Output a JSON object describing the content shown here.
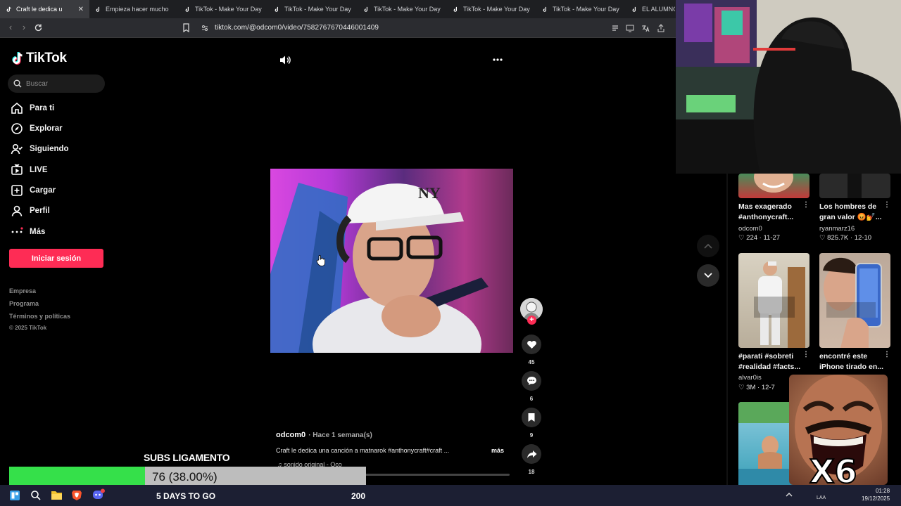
{
  "browser": {
    "tabs": [
      {
        "label": "Craft le dedica una canción",
        "active": true
      },
      {
        "label": "Empieza hacer mucho calor",
        "active": false
      },
      {
        "label": "TikTok - Make Your Day",
        "active": false
      },
      {
        "label": "TikTok - Make Your Day",
        "active": false
      },
      {
        "label": "TikTok - Make Your Day",
        "active": false
      },
      {
        "label": "TikTok - Make Your Day",
        "active": false
      },
      {
        "label": "TikTok - Make Your Day",
        "active": false
      },
      {
        "label": "EL ALUMNO I",
        "active": false
      }
    ],
    "url": "tiktok.com/@odcom0/video/7582767670446001409"
  },
  "sidebar": {
    "logo": "TikTok",
    "search_placeholder": "Buscar",
    "nav": [
      {
        "label": "Para ti",
        "icon": "home-icon"
      },
      {
        "label": "Explorar",
        "icon": "compass-icon"
      },
      {
        "label": "Siguiendo",
        "icon": "following-icon"
      },
      {
        "label": "LIVE",
        "icon": "live-icon"
      },
      {
        "label": "Cargar",
        "icon": "upload-icon"
      },
      {
        "label": "Perfil",
        "icon": "profile-icon"
      },
      {
        "label": "Más",
        "icon": "more-icon"
      }
    ],
    "login_label": "Iniciar sesión",
    "footer": [
      "Empresa",
      "Programa",
      "Términos y políticas",
      "© 2025 TikTok"
    ]
  },
  "video": {
    "likes": "45",
    "comments": "6",
    "saves": "9",
    "shares": "18",
    "author": "odcom0",
    "time_ago": "· Hace 1 semana(s)",
    "description": "Craft le dedica una canción a matnarok #anthonycraft#craft ...",
    "more_label": "más",
    "sound": "sonido original - Oco"
  },
  "recommendations": [
    {
      "title": "Mas exagerado #anthonycraft...",
      "user": "odcom0",
      "likes": "224",
      "date": "11-27"
    },
    {
      "title": "Los hombres de gran valor 😡💅...",
      "user": "ryanmarz16",
      "likes": "825.7K",
      "date": "12-10"
    },
    {
      "title": "#parati #sobreti #realidad #facts...",
      "user": "alvar0is",
      "likes": "3M",
      "date": "12-7"
    },
    {
      "title": "encontré este iPhone tirado en...",
      "user": "",
      "likes": "",
      "date": ""
    }
  ],
  "overlay": {
    "goal_title": "SUBS LIGAMENTO",
    "goal_value": "76 (38.00%)",
    "goal_progress": 0.38,
    "days_left": "5 DAYS TO GO",
    "target": "200",
    "emote_label": "X6"
  },
  "taskbar": {
    "time": "01:28",
    "date": "19/12/2025",
    "lang": "LAA"
  },
  "colors": {
    "accent": "#fe2c55",
    "goal_fill": "#35e04a"
  }
}
